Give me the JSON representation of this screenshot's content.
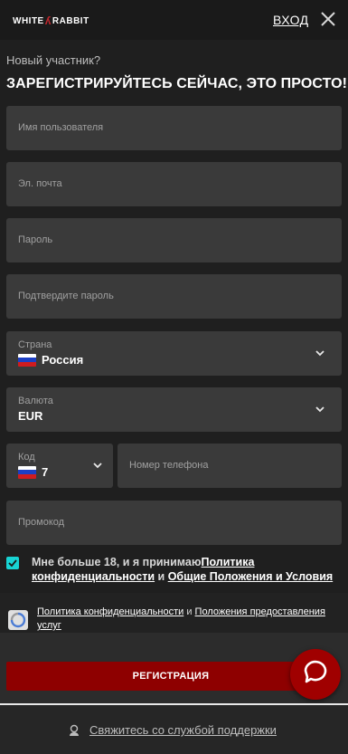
{
  "header": {
    "logo_left": "WHITE",
    "logo_right": "RABBIT",
    "login_label": "ВХОД"
  },
  "intro": {
    "subtitle": "Новый участник?",
    "headline": "ЗАРЕГИСТРИРУЙТЕСЬ СЕЙЧАС, ЭТО ПРОСТО!"
  },
  "form": {
    "username_placeholder": "Имя пользователя",
    "email_placeholder": "Эл. почта",
    "password_placeholder": "Пароль",
    "confirm_password_placeholder": "Подтвердите пароль",
    "country_label": "Страна",
    "country_value": "Россия",
    "currency_label": "Валюта",
    "currency_value": "EUR",
    "code_label": "Код",
    "code_value": "7",
    "phone_placeholder": "Номер телефона",
    "promo_placeholder": "Промокод"
  },
  "consent": {
    "checked": true,
    "text_before": "Мне больше 18, и я принимаю",
    "privacy_link": "Политика конфиденциальности",
    "and": " и ",
    "terms_link": "Общие Положения и Условия"
  },
  "captcha": {
    "privacy_link": "Политика конфиденциальности",
    "and": " и ",
    "terms_link": "Положения предоставления услуг"
  },
  "actions": {
    "register_label": "РЕГИСТРАЦИЯ"
  },
  "footer": {
    "support_label": "Свяжитесь со службой поддержки"
  },
  "colors": {
    "accent_red": "#8e0000",
    "chat_red": "#a00000",
    "checkbox_cyan": "#18d4d4",
    "field_bg": "#3a3a3a"
  },
  "icons": {
    "close": "close-icon",
    "chevron": "chevron-down-icon",
    "flag": "russia-flag-icon",
    "chat": "chat-icon",
    "support": "support-agent-icon",
    "captcha": "recaptcha-icon",
    "check": "checkmark-icon"
  }
}
